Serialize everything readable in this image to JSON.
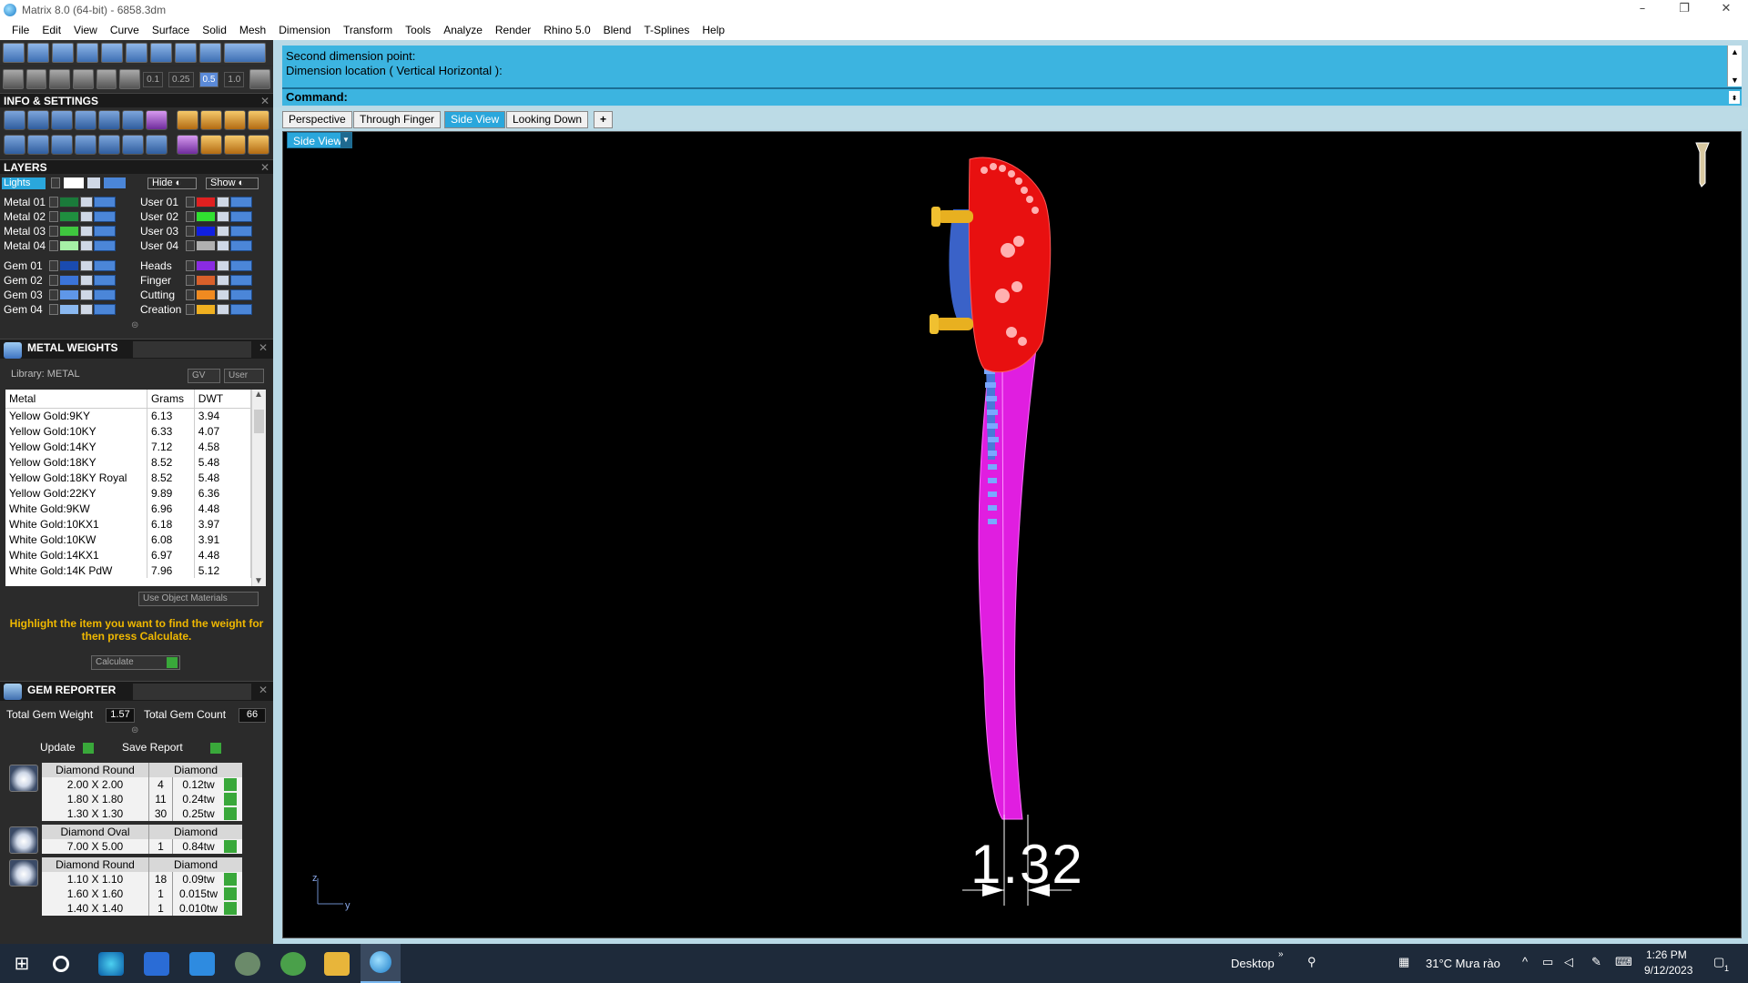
{
  "window": {
    "title": "Matrix 8.0 (64-bit) - 6858.3dm"
  },
  "menu": [
    "File",
    "Edit",
    "View",
    "Curve",
    "Surface",
    "Solid",
    "Mesh",
    "Dimension",
    "Transform",
    "Tools",
    "Analyze",
    "Render",
    "Rhino 5.0",
    "Blend",
    "T-Splines",
    "Help"
  ],
  "toolbar": {
    "snap_values": [
      "0.1",
      "0.25",
      "0.5",
      "1.0"
    ],
    "active_snap": "0.5"
  },
  "info_settings": {
    "title": "INFO & SETTINGS"
  },
  "layers": {
    "title": "LAYERS",
    "lights_label": "Lights",
    "hide_label": "Hide",
    "show_label": "Show",
    "left": [
      {
        "name": "Metal 01",
        "color": "#1a7a3a"
      },
      {
        "name": "Metal 02",
        "color": "#1f8f3f"
      },
      {
        "name": "Metal 03",
        "color": "#3fc63f"
      },
      {
        "name": "Metal 04",
        "color": "#a6f0a6"
      },
      {
        "name": "Gem 01",
        "color": "#1a4bb0"
      },
      {
        "name": "Gem 02",
        "color": "#3b74d8"
      },
      {
        "name": "Gem 03",
        "color": "#5f97e8"
      },
      {
        "name": "Gem 04",
        "color": "#8ab8f0"
      }
    ],
    "right": [
      {
        "name": "User 01",
        "color": "#e02020"
      },
      {
        "name": "User 02",
        "color": "#30e030"
      },
      {
        "name": "User 03",
        "color": "#1020e0"
      },
      {
        "name": "User 04",
        "color": "#b0b0b0"
      },
      {
        "name": "Heads",
        "color": "#8a2be2"
      },
      {
        "name": "Finger",
        "color": "#d8602a"
      },
      {
        "name": "Cutting",
        "color": "#f08a20"
      },
      {
        "name": "Creation",
        "color": "#f0b020"
      }
    ]
  },
  "metal_weights": {
    "title": "METAL WEIGHTS",
    "library_label": "Library: METAL",
    "toggle_gv": "GV",
    "toggle_user": "User",
    "columns": [
      "Metal",
      "Grams",
      "DWT"
    ],
    "rows": [
      [
        "Yellow Gold:9KY",
        "6.13",
        "3.94"
      ],
      [
        "Yellow Gold:10KY",
        "6.33",
        "4.07"
      ],
      [
        "Yellow Gold:14KY",
        "7.12",
        "4.58"
      ],
      [
        "Yellow Gold:18KY",
        "8.52",
        "5.48"
      ],
      [
        "Yellow Gold:18KY Royal",
        "8.52",
        "5.48"
      ],
      [
        "Yellow Gold:22KY",
        "9.89",
        "6.36"
      ],
      [
        "White Gold:9KW",
        "6.96",
        "4.48"
      ],
      [
        "White Gold:10KX1",
        "6.18",
        "3.97"
      ],
      [
        "White Gold:10KW",
        "6.08",
        "3.91"
      ],
      [
        "White Gold:14KX1",
        "6.97",
        "4.48"
      ],
      [
        "White Gold:14K PdW",
        "7.96",
        "5.12"
      ]
    ],
    "use_object_materials": "Use Object Materials",
    "hint": "Highlight the item you want to find the weight for then press Calculate.",
    "calculate": "Calculate"
  },
  "gem_reporter": {
    "title": "GEM REPORTER",
    "total_weight_label": "Total Gem Weight",
    "total_weight": "1.57",
    "total_count_label": "Total Gem Count",
    "total_count": "66",
    "update": "Update",
    "save_report": "Save Report",
    "groups": [
      {
        "shape": "Diamond Round",
        "material": "Diamond",
        "rows": [
          [
            "2.00 X 2.00",
            "4",
            "0.12tw"
          ],
          [
            "1.80 X 1.80",
            "11",
            "0.24tw"
          ],
          [
            "1.30 X 1.30",
            "30",
            "0.25tw"
          ]
        ]
      },
      {
        "shape": "Diamond Oval",
        "material": "Diamond",
        "rows": [
          [
            "7.00 X 5.00",
            "1",
            "0.84tw"
          ]
        ]
      },
      {
        "shape": "Diamond Round",
        "material": "Diamond",
        "rows": [
          [
            "1.10 X 1.10",
            "18",
            "0.09tw"
          ],
          [
            "1.60 X 1.60",
            "1",
            "0.015tw"
          ],
          [
            "1.40 X 1.40",
            "1",
            "0.010tw"
          ]
        ]
      }
    ]
  },
  "command": {
    "line1": "Second dimension point:",
    "line2": "Dimension location ( Vertical  Horizontal ):",
    "prompt": "Command:"
  },
  "viewtabs": [
    "Perspective",
    "Through Finger",
    "Side View",
    "Looking Down"
  ],
  "active_view": "Side View",
  "viewport": {
    "label": "Side View",
    "dimension_value": "1.32",
    "axis_z": "z",
    "axis_y": "y"
  },
  "taskbar": {
    "desktop": "Desktop",
    "weather": "31°C  Mưa rào",
    "time": "1:26 PM",
    "date": "9/12/2023",
    "notif_count": "1"
  }
}
